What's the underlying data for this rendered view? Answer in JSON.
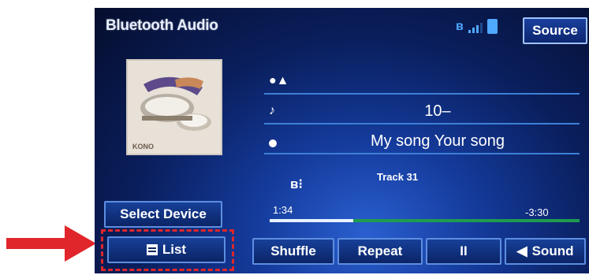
{
  "header": {
    "title": "Bluetooth Audio",
    "source_label": "Source"
  },
  "status": {
    "icons": [
      "bluetooth-icon",
      "signal-icon",
      "battery-icon"
    ],
    "accent_color": "#4fa8ff"
  },
  "album": {
    "label": "KONO"
  },
  "info": {
    "artist": "",
    "album_name": "10–",
    "song": "My song Your song"
  },
  "playback": {
    "track_label": "Track 31",
    "elapsed": "1:34",
    "remaining": "-3:30",
    "progress_fraction": 0.27
  },
  "controls": {
    "select_device_label": "Select Device",
    "list_label": "List",
    "shuffle_label": "Shuffle",
    "repeat_label": "Repeat",
    "pause_label": "II",
    "sound_label": "Sound"
  },
  "annotation": {
    "highlight_color": "#e0262a"
  }
}
